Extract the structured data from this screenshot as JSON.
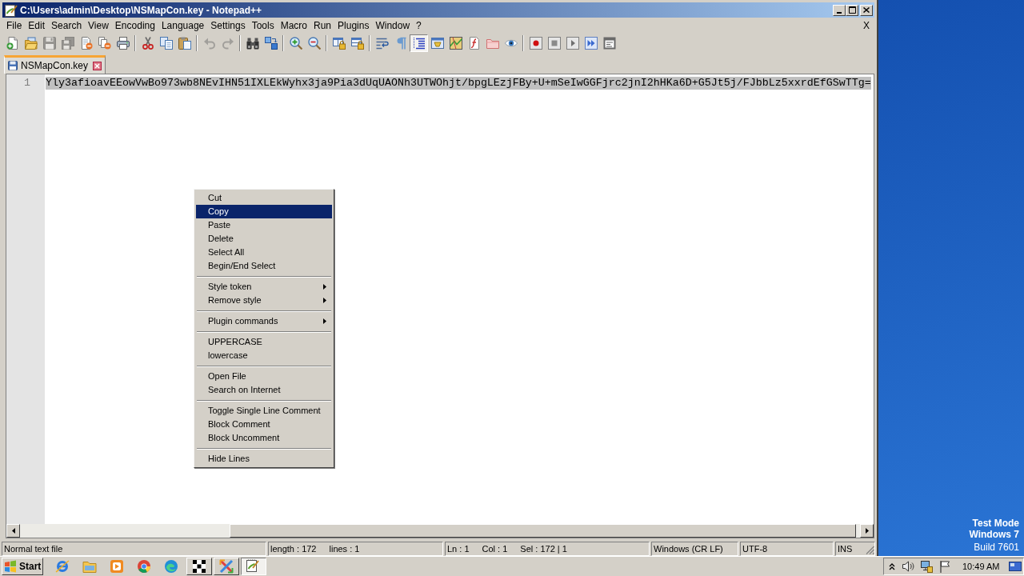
{
  "window": {
    "title": "C:\\Users\\admin\\Desktop\\NSMapCon.key - Notepad++"
  },
  "menu_bar": {
    "items": [
      "File",
      "Edit",
      "Search",
      "View",
      "Encoding",
      "Language",
      "Settings",
      "Tools",
      "Macro",
      "Run",
      "Plugins",
      "Window",
      "?"
    ],
    "close_document": "X"
  },
  "toolbar": {
    "groups": [
      {
        "buttons": [
          {
            "kind": "new",
            "pressed": false,
            "disabled": false
          },
          {
            "kind": "open",
            "pressed": false,
            "disabled": false
          },
          {
            "kind": "save",
            "pressed": false,
            "disabled": true
          },
          {
            "kind": "saveall",
            "pressed": false,
            "disabled": true
          },
          {
            "kind": "close",
            "pressed": false,
            "disabled": false
          },
          {
            "kind": "closeall",
            "pressed": false,
            "disabled": false
          },
          {
            "kind": "print",
            "pressed": false,
            "disabled": false
          }
        ]
      },
      {
        "buttons": [
          {
            "kind": "cut",
            "pressed": false,
            "disabled": false
          },
          {
            "kind": "copy",
            "pressed": false,
            "disabled": false
          },
          {
            "kind": "paste",
            "pressed": false,
            "disabled": false
          }
        ]
      },
      {
        "buttons": [
          {
            "kind": "undo",
            "pressed": false,
            "disabled": true
          },
          {
            "kind": "redo",
            "pressed": false,
            "disabled": true
          }
        ]
      },
      {
        "buttons": [
          {
            "kind": "find",
            "pressed": false,
            "disabled": false
          },
          {
            "kind": "replace",
            "pressed": false,
            "disabled": false
          }
        ]
      },
      {
        "buttons": [
          {
            "kind": "zoomin",
            "pressed": false,
            "disabled": false
          },
          {
            "kind": "zoomout",
            "pressed": false,
            "disabled": false
          }
        ]
      },
      {
        "buttons": [
          {
            "kind": "syncv",
            "pressed": false,
            "disabled": false
          },
          {
            "kind": "synch",
            "pressed": false,
            "disabled": false
          }
        ]
      },
      {
        "buttons": [
          {
            "kind": "wrap",
            "pressed": false,
            "disabled": false
          },
          {
            "kind": "allchars",
            "pressed": false,
            "disabled": false
          },
          {
            "kind": "indent",
            "pressed": true,
            "disabled": false
          },
          {
            "kind": "udl",
            "pressed": false,
            "disabled": false
          },
          {
            "kind": "docmap",
            "pressed": false,
            "disabled": false
          },
          {
            "kind": "funclist",
            "pressed": false,
            "disabled": false
          },
          {
            "kind": "workspace",
            "pressed": false,
            "disabled": false
          },
          {
            "kind": "monitor",
            "pressed": false,
            "disabled": false
          }
        ]
      },
      {
        "buttons": [
          {
            "kind": "record",
            "pressed": false,
            "disabled": false
          },
          {
            "kind": "stop",
            "pressed": false,
            "disabled": false
          },
          {
            "kind": "play",
            "pressed": false,
            "disabled": false
          },
          {
            "kind": "playmulti",
            "pressed": false,
            "disabled": false
          },
          {
            "kind": "savemacro",
            "pressed": false,
            "disabled": false
          }
        ]
      }
    ]
  },
  "tabs": [
    {
      "label": "NSMapCon.key",
      "selected": true
    }
  ],
  "editor": {
    "lines": [
      {
        "number": "1",
        "text": "Yly3afioavEEowVwBo973wb8NEvIHN51IXLEkWyhx3ja9Pia3dUqUAONh3UTWOhjt/bpgLEzjFBy+U+mSeIwGGFjrc2jnI2hHKa6D+G5Jt5j/FJbbLz5xxrdEfGSwTTg=",
        "selected": true
      }
    ]
  },
  "context_menu": {
    "groups": [
      {
        "items": [
          {
            "label": "Cut",
            "selected": false,
            "submenu": false
          },
          {
            "label": "Copy",
            "selected": true,
            "submenu": false
          },
          {
            "label": "Paste",
            "selected": false,
            "submenu": false
          },
          {
            "label": "Delete",
            "selected": false,
            "submenu": false
          },
          {
            "label": "Select All",
            "selected": false,
            "submenu": false
          },
          {
            "label": "Begin/End Select",
            "selected": false,
            "submenu": false
          }
        ]
      },
      {
        "items": [
          {
            "label": "Style token",
            "selected": false,
            "submenu": true
          },
          {
            "label": "Remove style",
            "selected": false,
            "submenu": true
          }
        ]
      },
      {
        "items": [
          {
            "label": "Plugin commands",
            "selected": false,
            "submenu": true
          }
        ]
      },
      {
        "items": [
          {
            "label": "UPPERCASE",
            "selected": false,
            "submenu": false
          },
          {
            "label": "lowercase",
            "selected": false,
            "submenu": false
          }
        ]
      },
      {
        "items": [
          {
            "label": "Open File",
            "selected": false,
            "submenu": false
          },
          {
            "label": "Search on Internet",
            "selected": false,
            "submenu": false
          }
        ]
      },
      {
        "items": [
          {
            "label": "Toggle Single Line Comment",
            "selected": false,
            "submenu": false
          },
          {
            "label": "Block Comment",
            "selected": false,
            "submenu": false
          },
          {
            "label": "Block Uncomment",
            "selected": false,
            "submenu": false
          }
        ]
      },
      {
        "items": [
          {
            "label": "Hide Lines",
            "selected": false,
            "submenu": false
          }
        ]
      }
    ]
  },
  "status_bar": {
    "segments": [
      {
        "texts": [
          "Normal text file"
        ]
      },
      {
        "texts": [
          "length : 172",
          "lines : 1"
        ]
      },
      {
        "texts": [
          "Ln : 1",
          "Col : 1",
          "Sel : 172 | 1"
        ]
      },
      {
        "texts": [
          "Windows (CR LF)"
        ]
      },
      {
        "texts": [
          "UTF-8"
        ]
      },
      {
        "texts": [
          "INS"
        ]
      }
    ]
  },
  "desktop": {
    "notice_lines": [
      "Test Mode",
      "Windows 7"
    ],
    "build": "Build 7601"
  },
  "taskbar": {
    "start": "Start",
    "quick_launch": [
      {
        "kind": "ebrowser"
      },
      {
        "kind": "folder"
      },
      {
        "kind": "media"
      },
      {
        "kind": "tricolor"
      },
      {
        "kind": "swirl"
      }
    ],
    "windows": [
      {
        "kind": "grid",
        "selected": false
      },
      {
        "kind": "cross",
        "selected": false
      },
      {
        "kind": "notepad",
        "selected": true
      }
    ],
    "clock": "10:49 AM"
  }
}
